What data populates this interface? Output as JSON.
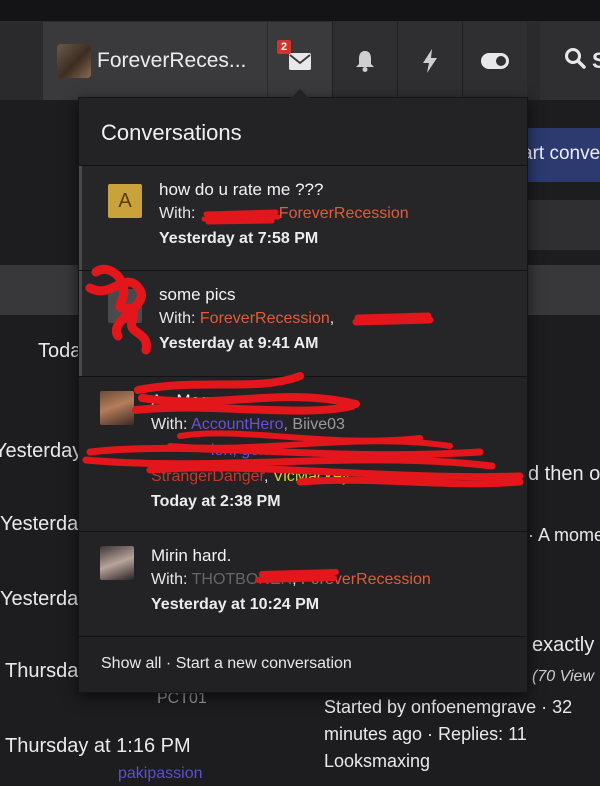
{
  "navbar": {
    "username": "ForeverReces...",
    "conversations_badge": "2",
    "search_label": "S"
  },
  "background": {
    "start_button": "art conve",
    "left_labels": [
      "Toda",
      "Yesterday",
      "Yesterda",
      "Yesterda",
      "Thursda",
      "Thursday at 1:16 PM"
    ],
    "right_snippets": [
      "d then o",
      "· A mome",
      "exactly",
      "(70 View"
    ],
    "thread_meta": {
      "started_by": "Started by onfoenemgrave · 32",
      "time_replies": "minutes ago · Replies: 11",
      "forum": "Looksmaxing"
    },
    "small_users": [
      "PCT01",
      "pakipassion"
    ]
  },
  "dropdown": {
    "title": "Conversations",
    "items": [
      {
        "avatar_letter": "A",
        "subject": "how do u rate me ???",
        "with_label": "With:",
        "participants": ", ForeverRecession",
        "time": "Yesterday at 7:58 PM"
      },
      {
        "subject": "some pics",
        "with_label": "With:",
        "participants": "ForeverRecession",
        "participants_tail": ",",
        "time": "Yesterday at 9:41 AM"
      },
      {
        "subject": "Ae    Mega",
        "with_label": "With:",
        "participants_line1": "AccountHero",
        "participants_line1b": ", Biive03",
        "participants_line2": "ion, gen",
        "participants_line3a": "StrangerDanger",
        "participants_line3b": "VicMackey",
        "time": "Today at 2:38 PM"
      },
      {
        "subject": "Mirin hard.",
        "with_label": "With:",
        "participant_a": "THOTBONER",
        "participant_b": "ForeverRecession",
        "time": "Yesterday at 10:24 PM"
      }
    ],
    "footer": {
      "show_all": "Show all",
      "separator": " · ",
      "start_new": "Start a new conversation"
    }
  },
  "colors": {
    "username_accent": "#e05c3a",
    "badge": "#d3332b",
    "redaction": "#e3161c"
  }
}
